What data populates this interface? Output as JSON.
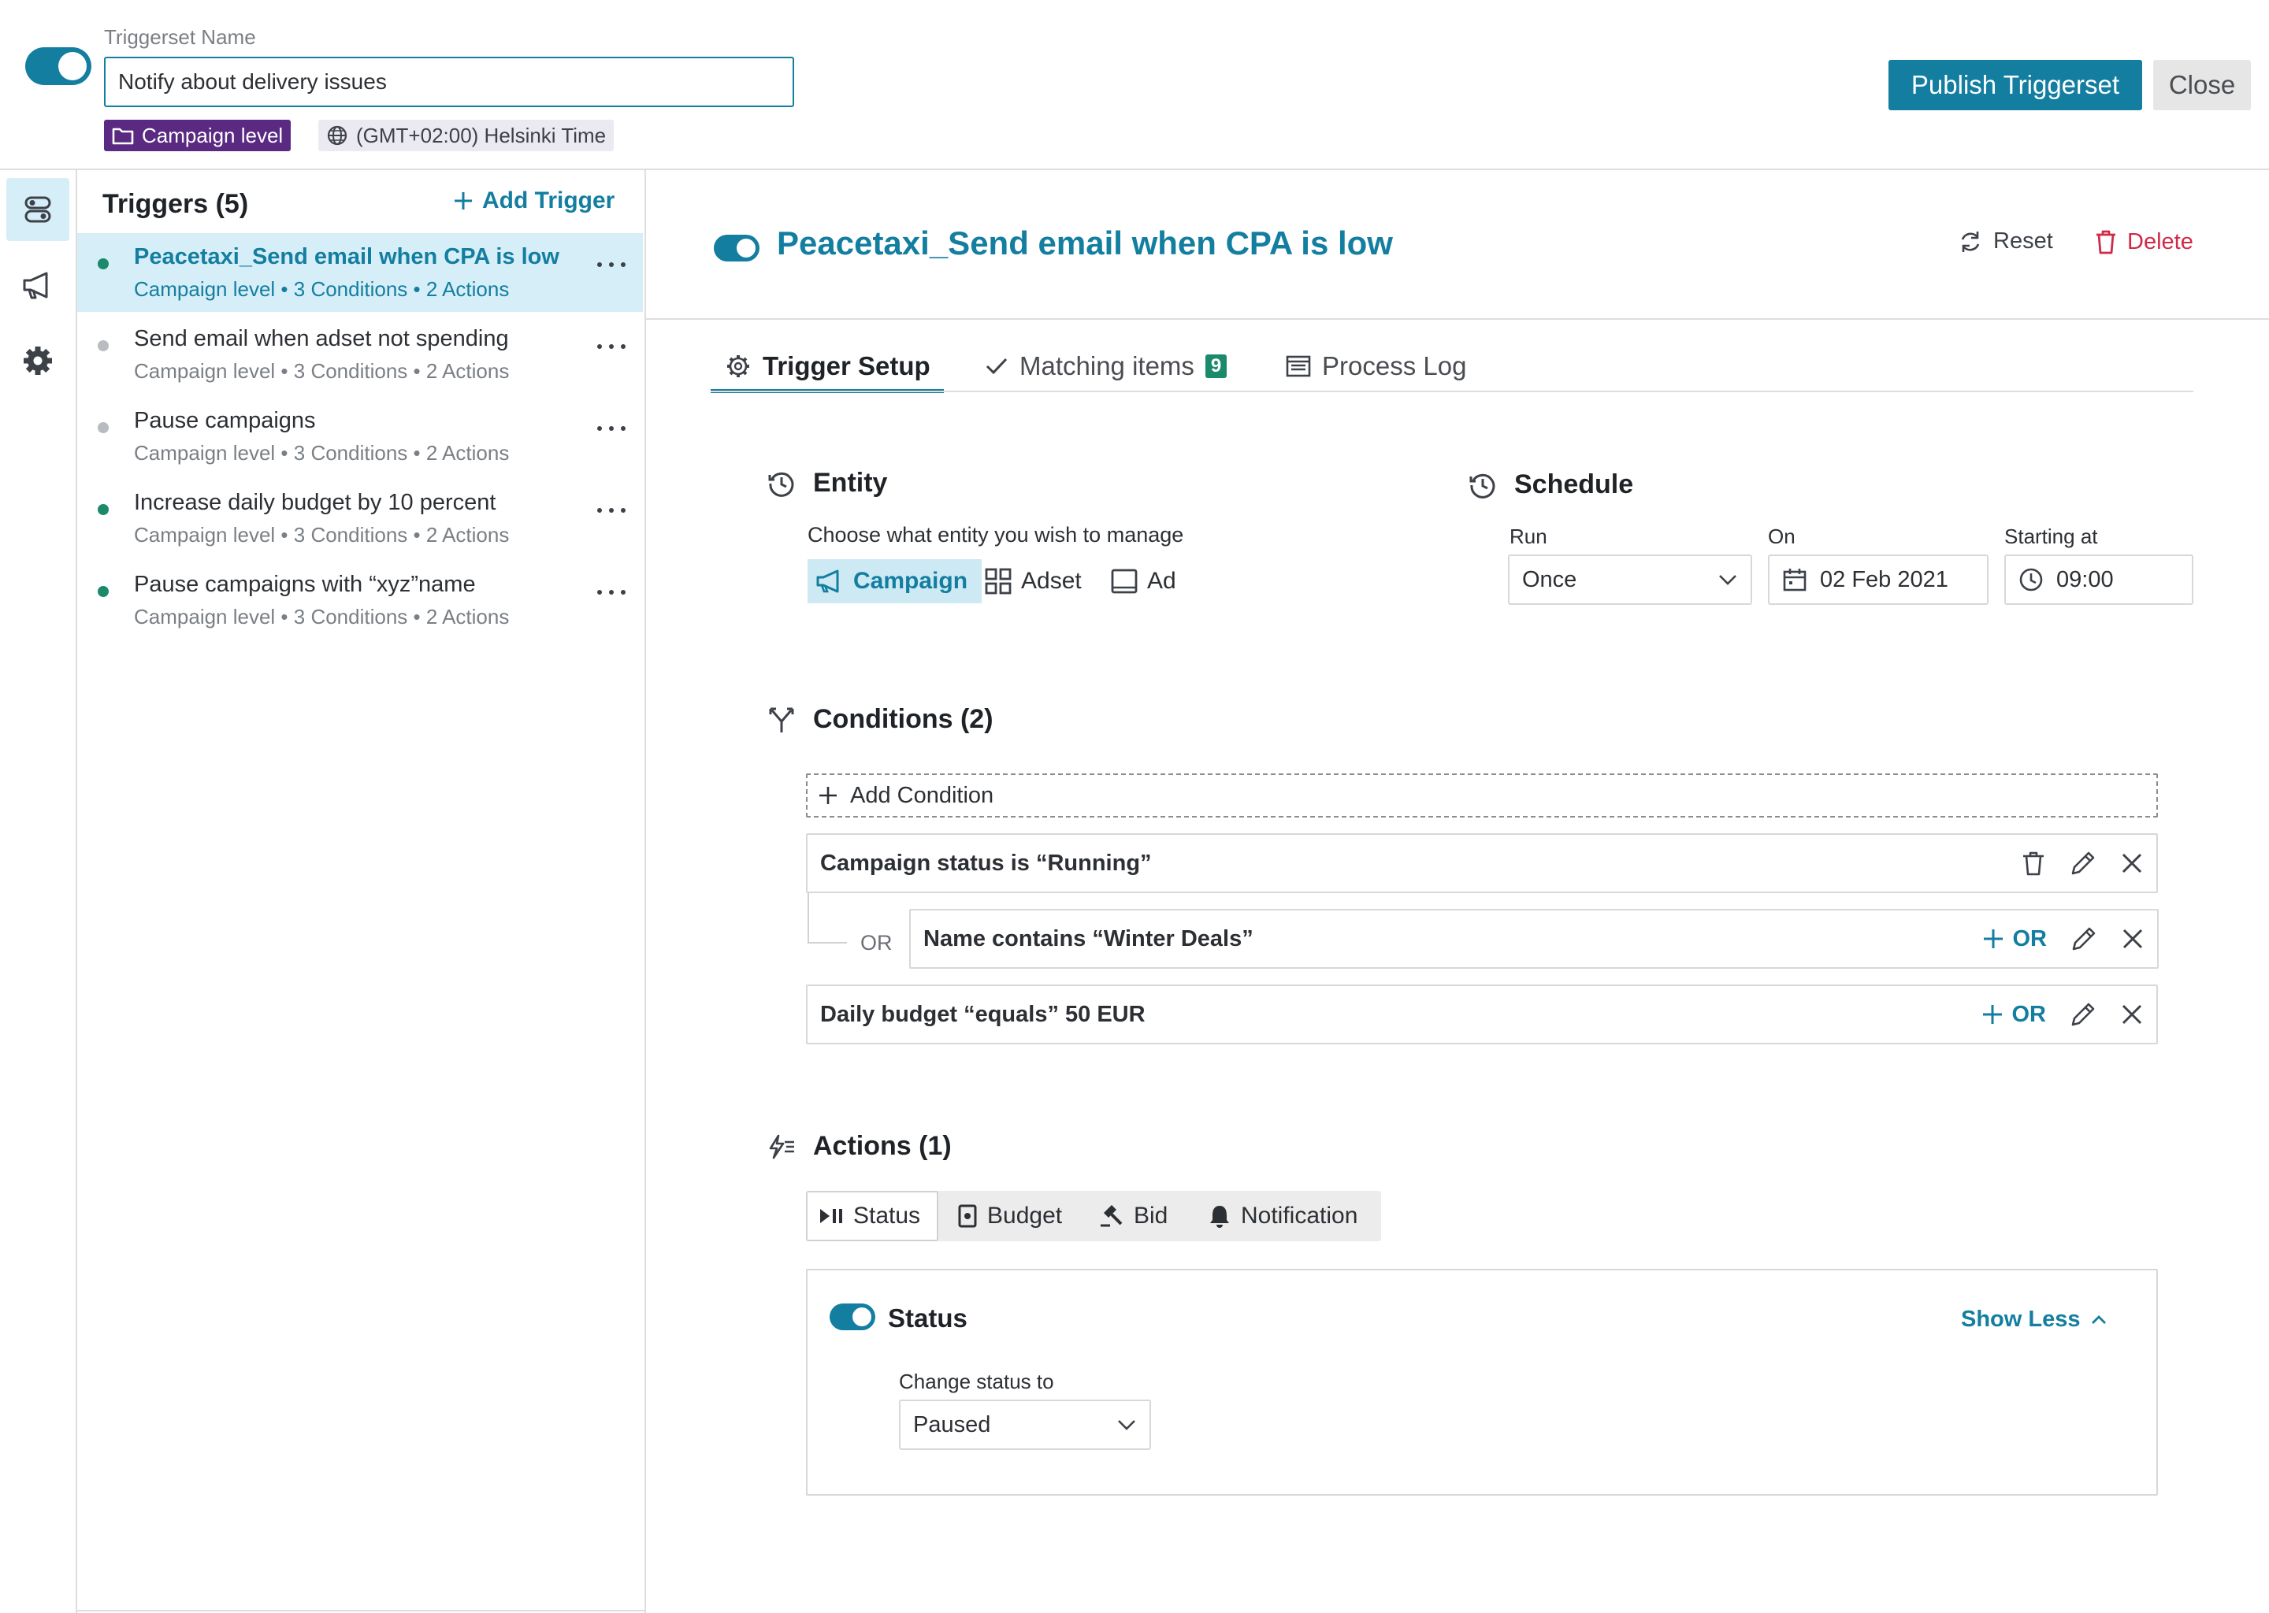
{
  "header": {
    "triggerset_label": "Triggerset Name",
    "triggerset_name": "Notify about delivery issues",
    "level_badge": "Campaign level",
    "timezone_badge": "(GMT+02:00) Helsinki Time",
    "publish_label": "Publish Triggerset",
    "close_label": "Close",
    "enabled": true
  },
  "sidebar": {
    "title": "Triggers (5)",
    "add_label": "Add Trigger",
    "items": [
      {
        "title": "Peacetaxi_Send email when CPA is low",
        "meta": "Campaign level • 3 Conditions • 2 Actions",
        "status": "active",
        "selected": true
      },
      {
        "title": "Send email when adset not spending",
        "meta": "Campaign level • 3 Conditions • 2 Actions",
        "status": "inactive",
        "selected": false
      },
      {
        "title": "Pause campaigns",
        "meta": "Campaign level • 3 Conditions • 2 Actions",
        "status": "inactive",
        "selected": false
      },
      {
        "title": "Increase daily budget by 10 percent",
        "meta": "Campaign level • 3 Conditions • 2 Actions",
        "status": "active",
        "selected": false
      },
      {
        "title": "Pause campaigns with “xyz”name",
        "meta": "Campaign level • 3 Conditions • 2 Actions",
        "status": "active",
        "selected": false
      }
    ]
  },
  "main": {
    "title": "Peacetaxi_Send email when CPA is low",
    "reset_label": "Reset",
    "delete_label": "Delete",
    "tabs": [
      {
        "label": "Trigger Setup",
        "active": true
      },
      {
        "label": "Matching items",
        "count": "9",
        "active": false
      },
      {
        "label": "Process Log",
        "active": false
      }
    ]
  },
  "entity": {
    "title": "Entity",
    "subtitle": "Choose what entity you wish to manage",
    "options": [
      {
        "label": "Campaign",
        "selected": true
      },
      {
        "label": "Adset",
        "selected": false
      },
      {
        "label": "Ad",
        "selected": false
      }
    ]
  },
  "schedule": {
    "title": "Schedule",
    "run_label": "Run",
    "run_value": "Once",
    "on_label": "On",
    "on_value": "02 Feb 2021",
    "start_label": "Starting at",
    "start_value": "09:00"
  },
  "conditions": {
    "title": "Conditions (2)",
    "add_label": "Add Condition",
    "or_connector": "OR",
    "or_button": "OR",
    "rows": [
      {
        "text": "Campaign status is “Running”"
      },
      {
        "text": "Name contains “Winter Deals”"
      },
      {
        "text": "Daily budget “equals” 50 EUR"
      }
    ]
  },
  "actions": {
    "title": "Actions (1)",
    "tabs": [
      "Status",
      "Budget",
      "Bid",
      "Notification"
    ],
    "active_tab": "Status",
    "card": {
      "title": "Status",
      "enabled": true,
      "show_less_label": "Show Less",
      "change_label": "Change status to",
      "change_value": "Paused"
    }
  },
  "colors": {
    "accent": "#137ea0",
    "active_dot": "#1b8a6b",
    "inactive_dot": "#b8bcc0",
    "danger": "#d02a4a",
    "level_badge": "#5a2a82",
    "selected_bg": "#d6eef7"
  }
}
